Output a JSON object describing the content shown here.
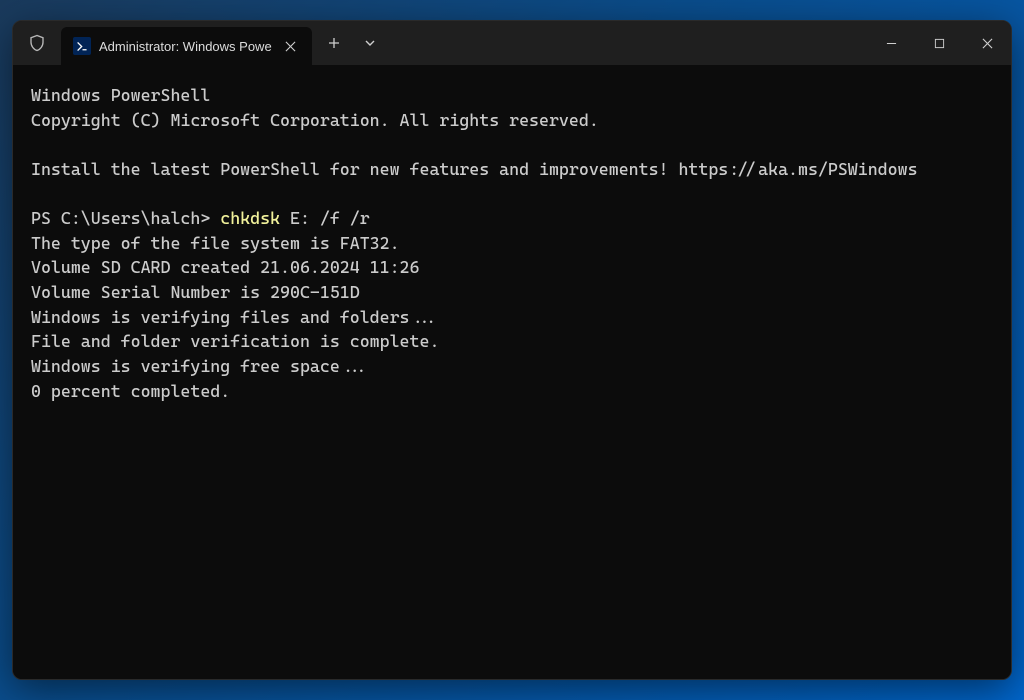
{
  "tab": {
    "title": "Administrator: Windows Powe"
  },
  "terminal": {
    "header1": "Windows PowerShell",
    "header2": "Copyright (C) Microsoft Corporation. All rights reserved.",
    "blank1": "",
    "install": "Install the latest PowerShell for new features and improvements! https://aka.ms/PSWindows",
    "blank2": "",
    "prompt": "PS C:\\Users\\halch> ",
    "cmd": "chkdsk",
    "cmd_args": " E: /f /r",
    "out1": "The type of the file system is FAT32.",
    "out2": "Volume SD CARD created 21.06.2024 11:26",
    "out3": "Volume Serial Number is 290C-151D",
    "out4": "Windows is verifying files and folders...",
    "out5": "File and folder verification is complete.",
    "out6": "Windows is verifying free space...",
    "out7": "0 percent completed."
  }
}
